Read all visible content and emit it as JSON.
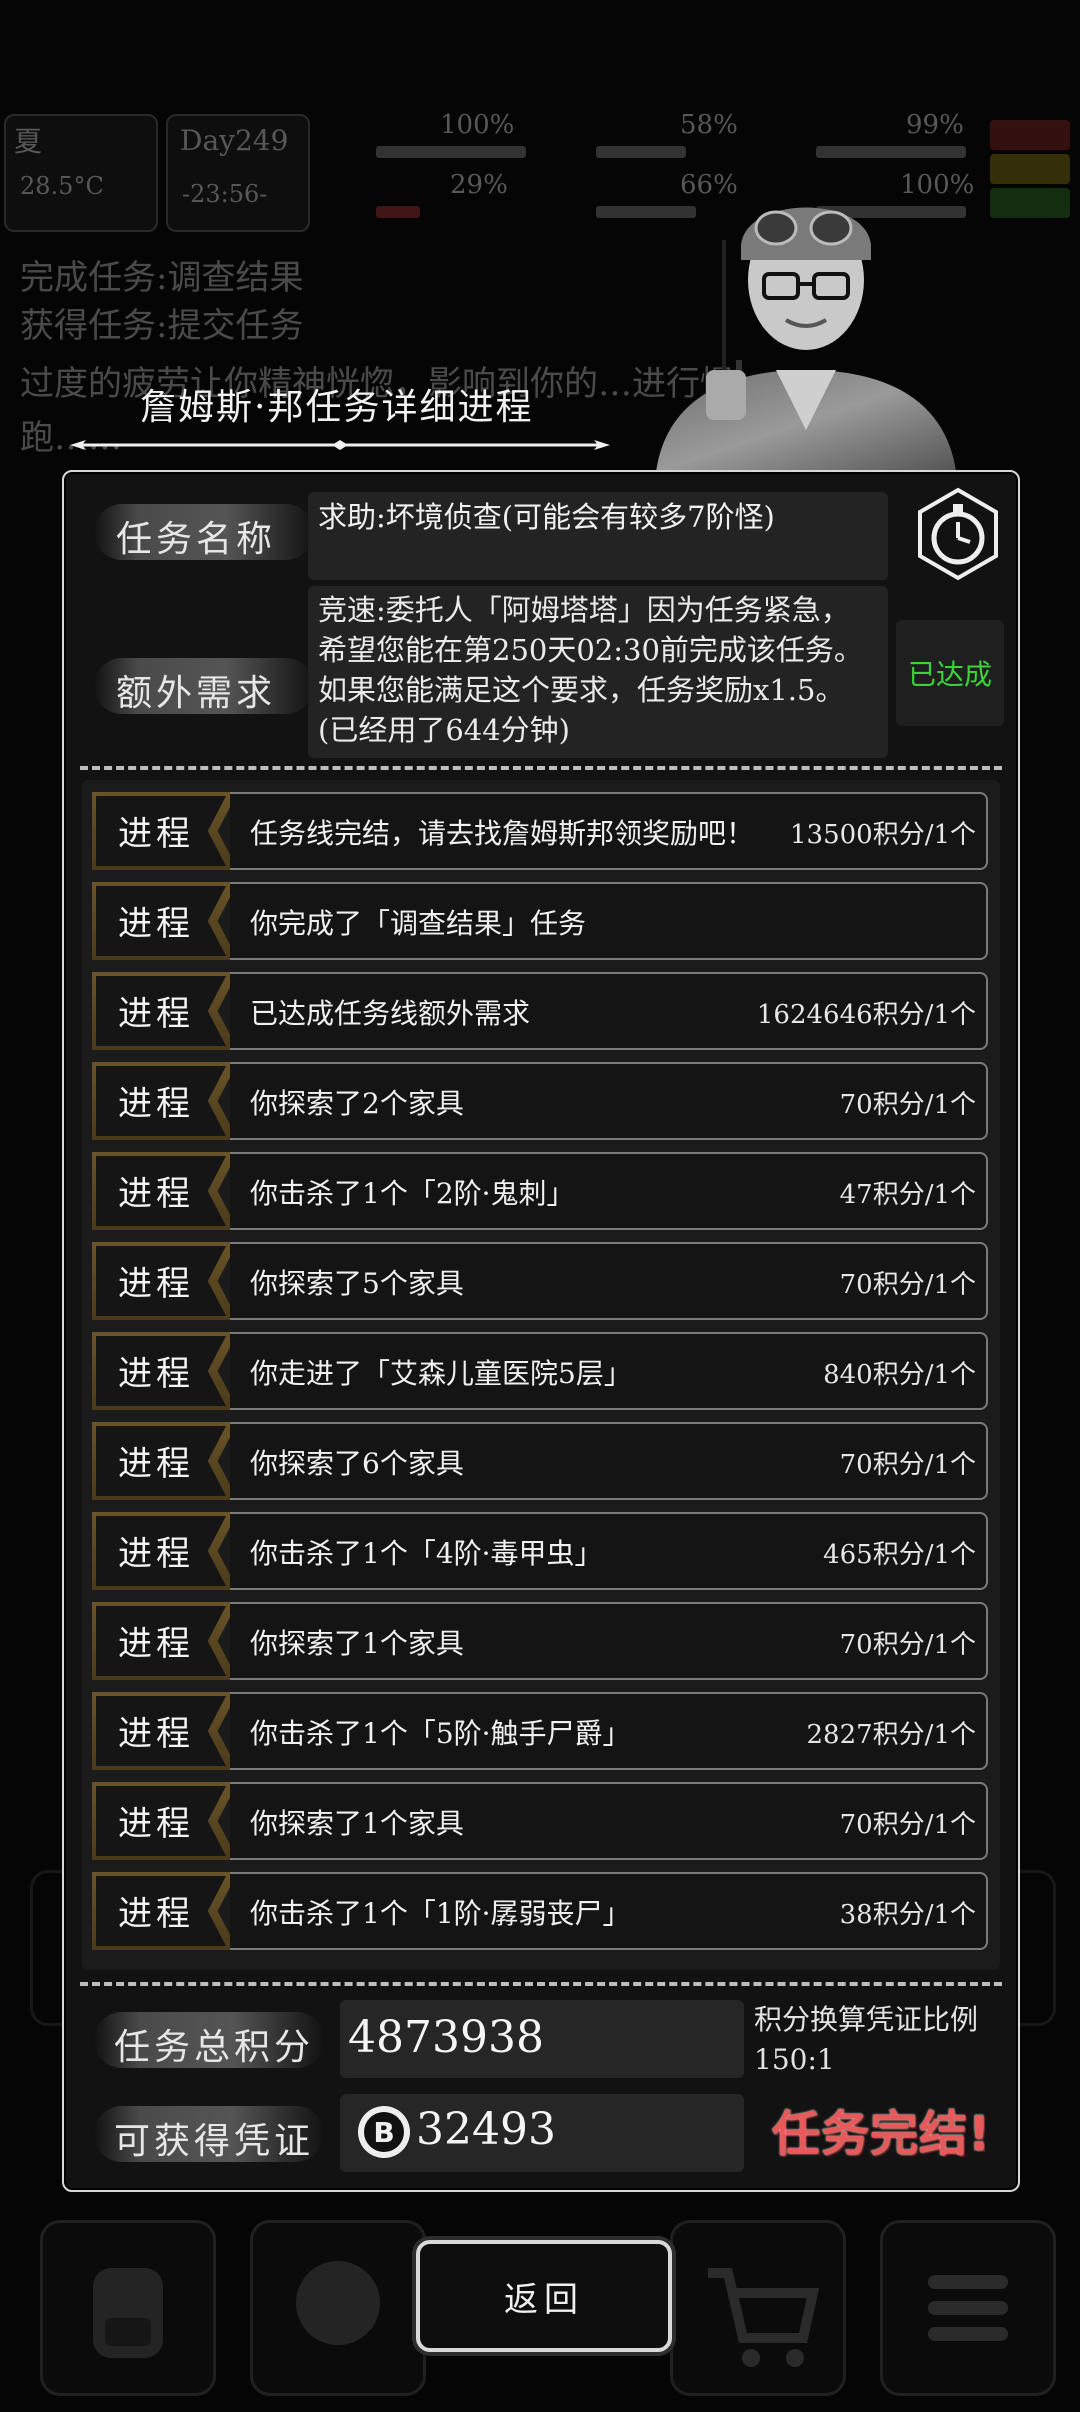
{
  "background": {
    "season": "夏",
    "temperature": "28.5°C",
    "day": "Day249",
    "time": "-23:56-",
    "stats": [
      "100%",
      "58%",
      "99%",
      "29%",
      "66%",
      "100%"
    ],
    "log_lines": [
      "完成任务:调查结果",
      "获得任务:提交任务",
      "过度的疲劳让你精神恍惚，影响到你的…进行慢",
      "跑……"
    ]
  },
  "dialog": {
    "title": "詹姆斯·邦任务详细进程",
    "quest_name_label": "任务名称",
    "quest_name": "求助:坏境侦查(可能会有较多7阶怪)",
    "extra_label": "额外需求",
    "extra_text": "竞速:委托人「阿姆塔塔」因为任务紧急，希望您能在第250天02:30前完成该任务。如果您能满足这个要求，任务奖励x1.5。(已经用了644分钟)",
    "extra_status": "已达成",
    "progress_tag": "进程",
    "progress": [
      {
        "text": "任务线完结，请去找詹姆斯邦领奖励吧！",
        "points": "13500积分/1个"
      },
      {
        "text": "你完成了「调查结果」任务",
        "points": ""
      },
      {
        "text": "已达成任务线额外需求",
        "points": "1624646积分/1个"
      },
      {
        "text": "你探索了2个家具",
        "points": "70积分/1个"
      },
      {
        "text": "你击杀了1个「2阶·鬼刺」",
        "points": "47积分/1个"
      },
      {
        "text": "你探索了5个家具",
        "points": "70积分/1个"
      },
      {
        "text": "你走进了「艾森儿童医院5层」",
        "points": "840积分/1个"
      },
      {
        "text": "你探索了6个家具",
        "points": "70积分/1个"
      },
      {
        "text": "你击杀了1个「4阶·毒甲虫」",
        "points": "465积分/1个"
      },
      {
        "text": "你探索了1个家具",
        "points": "70积分/1个"
      },
      {
        "text": "你击杀了1个「5阶·触手尸爵」",
        "points": "2827积分/1个"
      },
      {
        "text": "你探索了1个家具",
        "points": "70积分/1个"
      },
      {
        "text": "你击杀了1个「1阶·孱弱丧尸」",
        "points": "38积分/1个"
      }
    ],
    "total_label": "任务总积分",
    "total_value": "4873938",
    "voucher_label": "可获得凭证",
    "voucher_value": "32493",
    "ratio_text": "积分换算凭证比例150:1",
    "complete_text": "任务完结!",
    "back_label": "返回"
  },
  "colors": {
    "achieved": "#3bd23b",
    "complete": "#e85a5a",
    "tag_gold": "#6a5428"
  }
}
